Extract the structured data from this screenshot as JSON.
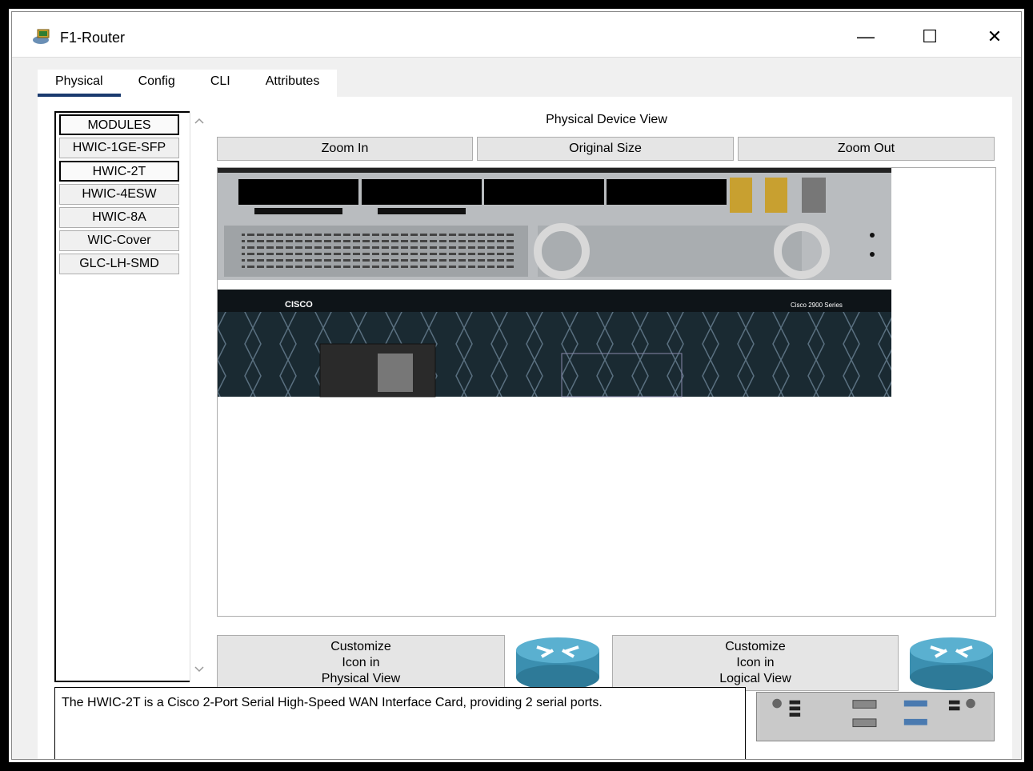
{
  "window": {
    "title": "F1-Router",
    "minimize": "—",
    "maximize": "☐",
    "close": "✕"
  },
  "tabs": [
    {
      "label": "Physical",
      "active": true
    },
    {
      "label": "Config"
    },
    {
      "label": "CLI"
    },
    {
      "label": "Attributes"
    }
  ],
  "sidebar": {
    "modules": [
      "MODULES",
      "HWIC-1GE-SFP",
      "HWIC-2T",
      "HWIC-4ESW",
      "HWIC-8A",
      "WIC-Cover",
      "GLC-LH-SMD"
    ],
    "selected": "HWIC-2T"
  },
  "viewer": {
    "title": "Physical Device View",
    "zoom_in": "Zoom In",
    "original_size": "Original Size",
    "zoom_out": "Zoom Out",
    "brand": "CISCO",
    "series_label": "Cisco 2900 Series"
  },
  "customize": {
    "physical": {
      "line1": "Customize",
      "line2": "Icon in",
      "line3": "Physical View"
    },
    "logical": {
      "line1": "Customize",
      "line2": "Icon in",
      "line3": "Logical View"
    }
  },
  "description": "The HWIC-2T is a Cisco 2-Port Serial High-Speed WAN Interface Card, providing 2 serial ports.",
  "colors": {
    "tab_underline": "#1a3a6e",
    "router_blue": "#3b8fb0"
  }
}
